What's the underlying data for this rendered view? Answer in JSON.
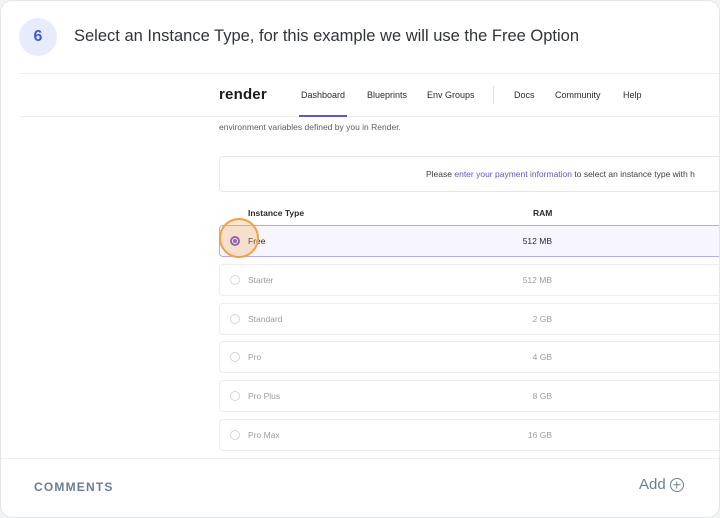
{
  "step": {
    "number": "6",
    "text": "Select an Instance Type, for this example we will use the Free Option"
  },
  "render_app": {
    "logo": "render",
    "nav": [
      "Dashboard",
      "Blueprints",
      "Env Groups",
      "Docs",
      "Community",
      "Help"
    ],
    "active_nav": "Dashboard",
    "env_text": "environment variables defined by you in Render.",
    "payment_notice": {
      "before": "Please ",
      "link": "enter your payment information",
      "after": " to select an instance type with h"
    },
    "table_headers": {
      "instance_type": "Instance Type",
      "ram": "RAM"
    },
    "rows": [
      {
        "name": "Free",
        "ram": "512 MB",
        "extra": "(",
        "selected": true
      },
      {
        "name": "Starter",
        "ram": "512 MB",
        "extra": "0",
        "selected": false
      },
      {
        "name": "Standard",
        "ram": "2 GB",
        "extra": "",
        "selected": false
      },
      {
        "name": "Pro",
        "ram": "4 GB",
        "extra": "",
        "selected": false
      },
      {
        "name": "Pro Plus",
        "ram": "8 GB",
        "extra": "",
        "selected": false
      },
      {
        "name": "Pro Max",
        "ram": "16 GB",
        "extra": "",
        "selected": false
      }
    ]
  },
  "footer": {
    "comments_label": "COMMENTS",
    "add_label": "Add"
  },
  "colors": {
    "accent": "#6b4fd3",
    "badge_bg": "#e7ebfb",
    "badge_text": "#3f5bd9",
    "highlight": "#f0a045"
  }
}
